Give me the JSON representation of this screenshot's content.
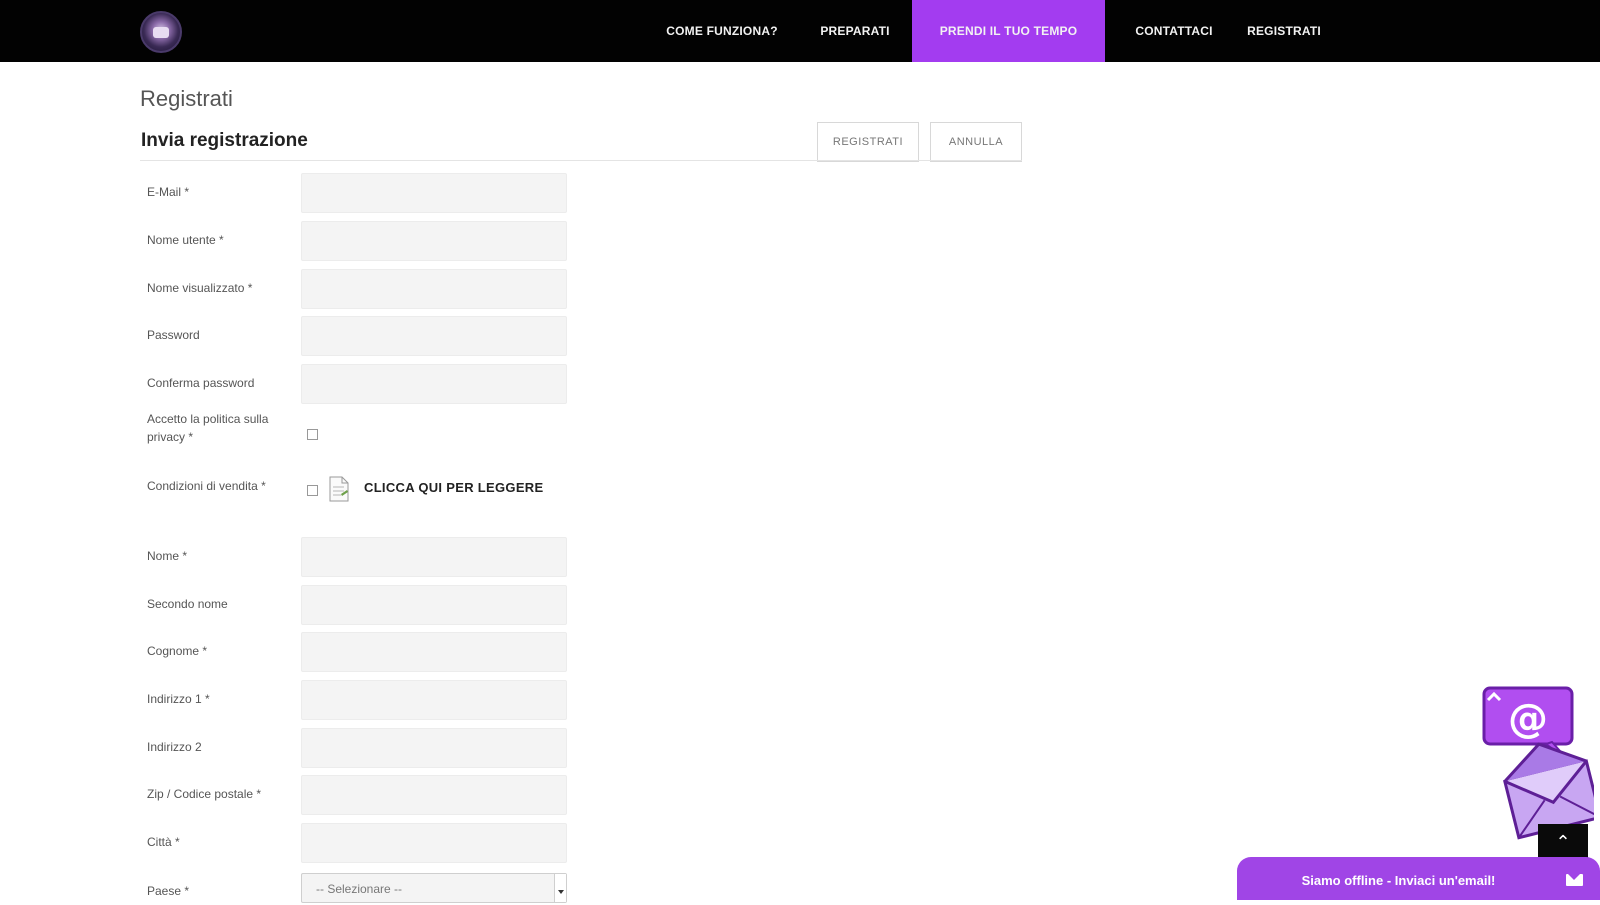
{
  "nav": {
    "items": [
      {
        "label": "COME FUNZIONA?",
        "active": false
      },
      {
        "label": "PREPARATI",
        "active": false
      },
      {
        "label": "PRENDI IL TUO TEMPO",
        "active": true
      },
      {
        "label": "CONTATTACI",
        "active": false
      },
      {
        "label": "REGISTRATI",
        "active": false
      }
    ],
    "active_color": "#a33cf0"
  },
  "page": {
    "title": "Registrati",
    "section_title": "Invia registrazione",
    "register_button": "REGISTRATI",
    "cancel_button": "ANNULLA"
  },
  "form": {
    "email": "E-Mail *",
    "username": "Nome utente *",
    "display_name": "Nome visualizzato *",
    "password": "Password",
    "confirm_password": "Conferma password",
    "privacy": "Accetto la politica sulla privacy *",
    "conditions": "Condizioni di vendita *",
    "read_link": "CLICCA QUI PER LEGGERE",
    "first_name": "Nome *",
    "middle_name": "Secondo nome",
    "last_name": "Cognome *",
    "address1": "Indirizzo 1 *",
    "address2": "Indirizzo 2",
    "zip": "Zip / Codice postale *",
    "city": "Città *",
    "country": "Paese *",
    "country_select": "-- Selezionare --"
  },
  "chat": {
    "label": "Siamo offline - Inviaci un'email!",
    "color": "#a045e6"
  }
}
